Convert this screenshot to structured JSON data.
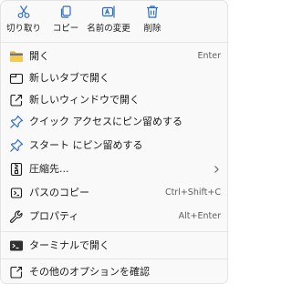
{
  "actions": [
    {
      "label": "切り取り",
      "icon": "scissors-icon"
    },
    {
      "label": "コピー",
      "icon": "copy-icon"
    },
    {
      "label": "名前の変更",
      "icon": "rename-icon"
    },
    {
      "label": "削除",
      "icon": "trash-icon"
    }
  ],
  "items": [
    {
      "label": "開く",
      "shortcut": "Enter",
      "icon": "folder-icon"
    },
    {
      "label": "新しいタブで開く",
      "icon": "new-tab-icon"
    },
    {
      "label": "新しいウィンドウで開く",
      "icon": "open-new-window-icon"
    },
    {
      "label": "クイック アクセスにピン留めする",
      "icon": "pin-icon"
    },
    {
      "label": "スタート にピン留めする",
      "icon": "pin-icon"
    },
    {
      "label": "圧縮先...",
      "icon": "archive-icon",
      "submenu": true
    },
    {
      "label": "パスのコピー",
      "shortcut": "Ctrl+Shift+C",
      "icon": "copy-path-icon"
    },
    {
      "label": "プロパティ",
      "shortcut": "Alt+Enter",
      "icon": "wrench-icon"
    },
    {
      "label": "ターミナルで開く",
      "icon": "terminal-icon"
    },
    {
      "label": "その他のオプションを確認",
      "icon": "more-options-icon"
    }
  ],
  "colors": {
    "accent": "#2b6cc4",
    "folder": "#f2c14e",
    "background": "#f9f9f9",
    "text": "#1a1a1a",
    "shortcut_text": "#5f5f5f"
  }
}
